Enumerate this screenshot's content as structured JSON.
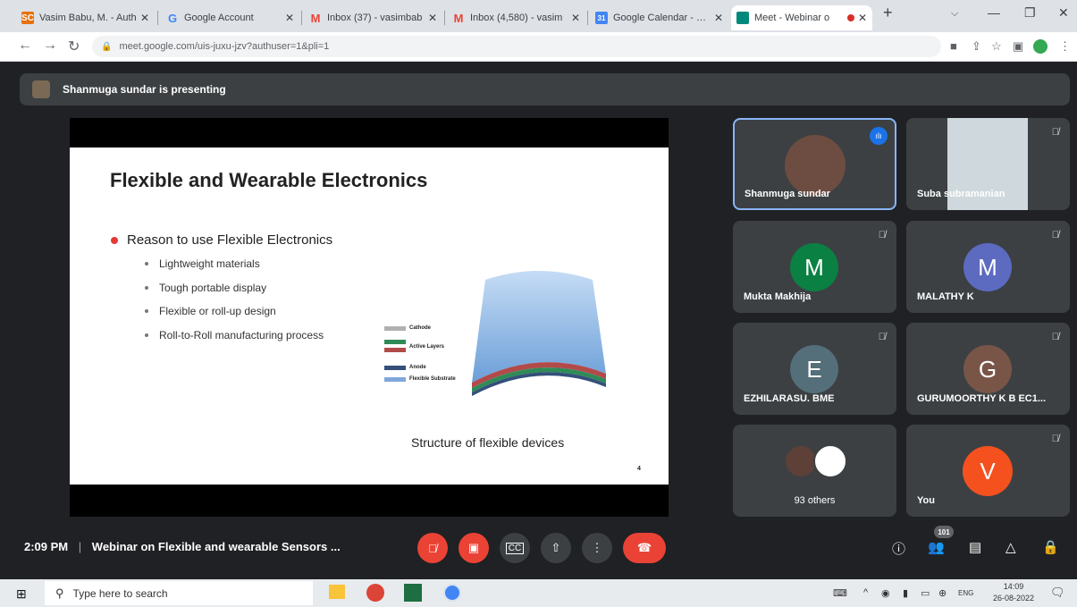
{
  "browser": {
    "tabs": [
      {
        "title": "Vasim Babu, M. - Auth",
        "favicon": "SC",
        "color": "#e8710a"
      },
      {
        "title": "Google Account",
        "favicon": "G",
        "color": "#4285f4"
      },
      {
        "title": "Inbox (37) - vasimbab",
        "favicon": "M",
        "color": "#ea4335"
      },
      {
        "title": "Inbox (4,580) - vasim",
        "favicon": "M",
        "color": "#ea4335"
      },
      {
        "title": "Google Calendar - We",
        "favicon": "31",
        "color": "#4285f4"
      },
      {
        "title": "Meet - Webinar o",
        "favicon": "",
        "color": "#00897b"
      }
    ],
    "new_tab": "+",
    "url": "meet.google.com/uis-juxu-jzv?authuser=1&pli=1"
  },
  "meet": {
    "presenting_text": "Shanmuga sundar is presenting",
    "slide": {
      "title": "Flexible and Wearable Electronics",
      "main_bullet": "Reason to use Flexible Electronics",
      "sub_bullets": [
        "Lightweight materials",
        "Tough portable display",
        "Flexible or roll-up design",
        "Roll-to-Roll manufacturing process"
      ],
      "legend": [
        "Cathode",
        "Active Layers",
        "Anode",
        "Flexible Substrate"
      ],
      "caption": "Structure of flexible devices",
      "page_number": "4"
    },
    "participants": [
      {
        "name": "Shanmuga sundar",
        "initial": "",
        "color": "#6d4c41"
      },
      {
        "name": "Suba subramanian",
        "initial": "",
        "color": "#cfd8dc"
      },
      {
        "name": "Mukta Makhija",
        "initial": "M",
        "color": "#0b8043"
      },
      {
        "name": "MALATHY K",
        "initial": "M",
        "color": "#5c6bc0"
      },
      {
        "name": "EZHILARASU. BME",
        "initial": "E",
        "color": "#546e7a"
      },
      {
        "name": "GURUMOORTHY K B EC1...",
        "initial": "G",
        "color": "#795548"
      },
      {
        "name": "93 others",
        "initial": "",
        "color": "#3c4043"
      },
      {
        "name": "You",
        "initial": "V",
        "color": "#f4511e"
      }
    ],
    "time": "2:09 PM",
    "separator": "|",
    "meeting_title": "Webinar on Flexible and wearable Sensors ...",
    "people_count": "101"
  },
  "taskbar": {
    "search_placeholder": "Type here to search",
    "lang": "ENG",
    "clock_time": "14:09",
    "clock_date": "26-08-2022"
  }
}
